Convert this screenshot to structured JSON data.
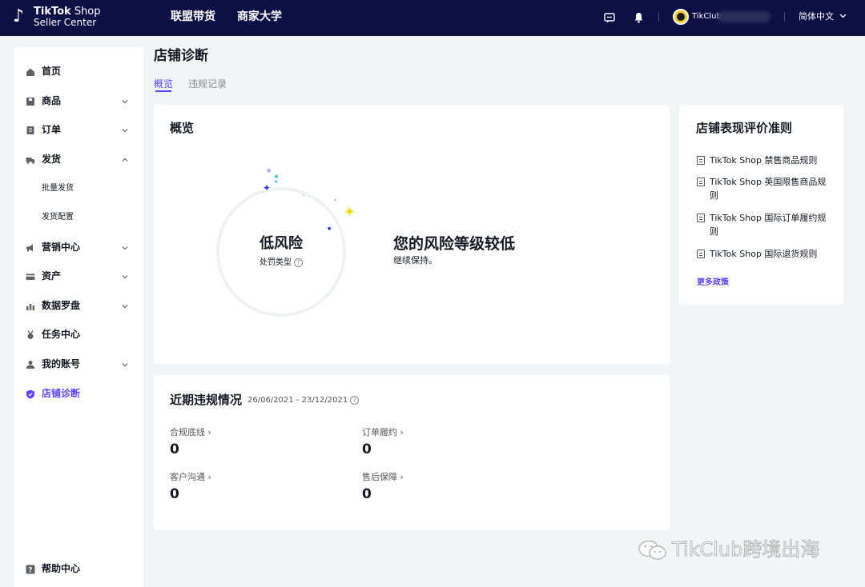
{
  "brand": {
    "line1_bold": "TikTok",
    "line1_thin": " Shop",
    "line2": "Seller Center"
  },
  "topnav": {
    "affiliate": "联盟带货",
    "university": "商家大学"
  },
  "account": {
    "name": "TikClub",
    "language": "简体中文"
  },
  "sidebar": {
    "items": [
      {
        "label": "首页",
        "icon": "home-icon"
      },
      {
        "label": "商品",
        "icon": "product-icon"
      },
      {
        "label": "订单",
        "icon": "order-icon"
      },
      {
        "label": "发货",
        "icon": "truck-icon"
      },
      {
        "label": "批量发货"
      },
      {
        "label": "发货配置"
      },
      {
        "label": "营销中心",
        "icon": "megaphone-icon"
      },
      {
        "label": "资产",
        "icon": "card-icon"
      },
      {
        "label": "数据罗盘",
        "icon": "chart-icon"
      },
      {
        "label": "任务中心",
        "icon": "medal-icon"
      },
      {
        "label": "我的账号",
        "icon": "user-icon"
      },
      {
        "label": "店铺诊断",
        "icon": "shield-icon"
      }
    ],
    "help": "帮助中心",
    "active": "店铺诊断"
  },
  "page": {
    "title": "店铺诊断",
    "tabs": [
      "概览",
      "违规记录"
    ],
    "active_tab": "概览"
  },
  "overview": {
    "title": "概览",
    "risk_level": "低风险",
    "penalty_type": "处罚类型",
    "headline": "您的风险等级较低",
    "subtext": "继续保持。"
  },
  "violations": {
    "title": "近期违规情况",
    "range": "26/06/2021 - 23/12/2021",
    "metrics": [
      {
        "label": "合规底线",
        "value": "0"
      },
      {
        "label": "订单履约",
        "value": "0"
      },
      {
        "label": "客户沟通",
        "value": "0"
      },
      {
        "label": "售后保障",
        "value": "0"
      }
    ]
  },
  "rules": {
    "title": "店铺表现评价准则",
    "items": [
      "TikTok Shop 禁售商品规则",
      "TikTok Shop 英国限售商品规则",
      "TikTok Shop 国际订单履约规则",
      "TikTok Shop 国际退货规则"
    ],
    "more": "更多政策"
  },
  "watermark": "TikClub跨境出海",
  "colors": {
    "topbar": "#0d1045",
    "accent": "#5b44ff",
    "page_bg": "#f3f4f6",
    "star_yellow": "#f5d90a"
  }
}
